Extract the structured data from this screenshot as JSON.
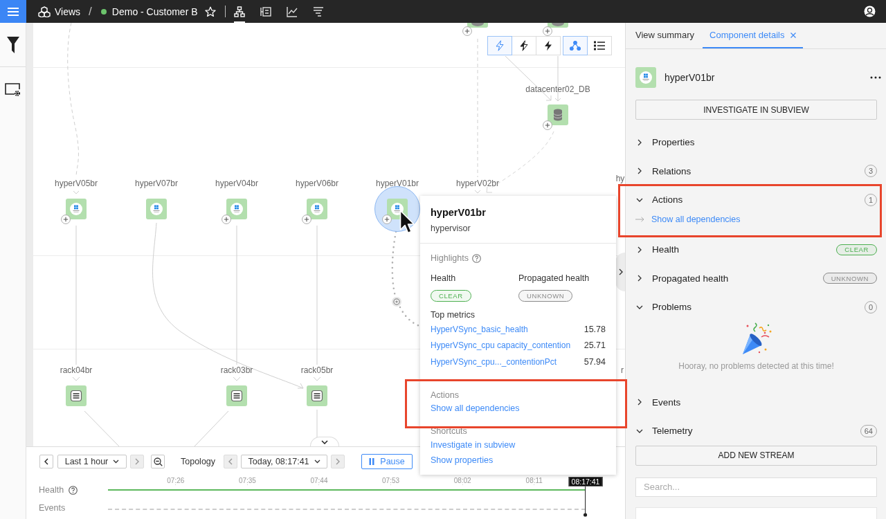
{
  "top_bar": {
    "root": "Views",
    "separator": "/",
    "view": {
      "name": "Demo - Customer B",
      "color": "#6cc46c"
    },
    "starred": false,
    "view_modes": [
      {
        "kind": "topology",
        "selected": true
      },
      {
        "kind": "components",
        "selected": false
      },
      {
        "kind": "metrics",
        "selected": false
      },
      {
        "kind": "events",
        "selected": false
      }
    ]
  },
  "canvas": {
    "toolbar": [
      {
        "kind": "bolt-outline",
        "selected": true
      },
      {
        "kind": "bolt-half",
        "selected": false
      },
      {
        "kind": "bolt-solid",
        "selected": false
      },
      {
        "kind": "graph",
        "selected": true
      },
      {
        "kind": "list",
        "selected": false
      }
    ],
    "nodes": [
      {
        "kind": "database",
        "expandable": true,
        "selected": false
      },
      {
        "kind": "database",
        "expandable": true,
        "selected": false
      },
      {
        "label": "datacenter02_DB",
        "kind": "database",
        "expandable": true,
        "selected": false
      },
      {
        "label": "hyperV05br",
        "kind": "windows",
        "expandable": true,
        "selected": false
      },
      {
        "label": "hyperV07br",
        "kind": "windows",
        "expandable": false,
        "selected": false
      },
      {
        "label": "hyperV04br",
        "kind": "windows",
        "expandable": true,
        "selected": false
      },
      {
        "label": "hyperV06br",
        "kind": "windows",
        "expandable": true,
        "selected": false
      },
      {
        "label": "hyperV01br",
        "kind": "windows",
        "expandable": true,
        "selected": true
      },
      {
        "label": "hyperV02br"
      },
      {
        "label": "hy"
      },
      {
        "label": "rack04br",
        "kind": "rack",
        "expandable": false,
        "selected": false
      },
      {
        "label": "rack03br",
        "kind": "rack",
        "expandable": false,
        "selected": false
      },
      {
        "label": "rack05br",
        "kind": "rack",
        "expandable": false,
        "selected": false
      },
      {
        "label": "r"
      }
    ]
  },
  "popup": {
    "title": "hyperV01br",
    "subtitle": "hypervisor",
    "highlights": "Highlights",
    "health": {
      "label": "Health",
      "status": {
        "label": "CLEAR",
        "color": "#4caf50"
      }
    },
    "propagated_health": {
      "label": "Propagated health",
      "status": {
        "label": "UNKNOWN",
        "color": "#8a8a8a"
      }
    },
    "metrics_title": "Top metrics",
    "metrics": [
      {
        "name": "HyperVSync_basic_health",
        "value": "15.78"
      },
      {
        "name": "HyperVSync_cpu capacity_contention",
        "value": "25.71"
      },
      {
        "name": "HyperVSync_cpu..._contentionPct",
        "value": "57.94"
      }
    ],
    "actions": {
      "title": "Actions",
      "highlighted": true,
      "links": [
        "Show all dependencies"
      ]
    },
    "shortcuts": {
      "title": "Shortcuts",
      "links": [
        "Investigate in subview",
        "Show properties"
      ]
    }
  },
  "details_panel": {
    "tabs": [
      {
        "label": "View summary",
        "selected": false,
        "closable": false
      },
      {
        "label": "Component details",
        "selected": true,
        "closable": true
      }
    ],
    "component": {
      "name": "hyperV01br",
      "kind": "windows"
    },
    "investigate_button": "INVESTIGATE IN SUBVIEW",
    "sections": [
      {
        "title": "Properties",
        "expanded": false,
        "highlighted": false
      },
      {
        "title": "Relations",
        "expanded": false,
        "highlighted": false,
        "count": "3"
      },
      {
        "title": "Actions",
        "expanded": true,
        "highlighted": true,
        "count": "1",
        "links": [
          "Show all dependencies"
        ]
      },
      {
        "title": "Health",
        "expanded": false,
        "highlighted": false,
        "status": {
          "label": "CLEAR",
          "color": "#4caf50"
        }
      },
      {
        "title": "Propagated health",
        "expanded": false,
        "highlighted": false,
        "status": {
          "label": "UNKNOWN",
          "color": "#8a8a8a"
        }
      },
      {
        "title": "Problems",
        "expanded": true,
        "highlighted": false,
        "count": "0",
        "empty_message": "Hooray, no problems detected at this time!"
      },
      {
        "title": "Events",
        "expanded": false,
        "highlighted": false
      },
      {
        "title": "Telemetry",
        "expanded": true,
        "highlighted": false,
        "count": "64",
        "button": "ADD NEW STREAM",
        "search": {
          "placeholder": "Search..."
        }
      }
    ]
  },
  "timeline": {
    "range": {
      "label": "Last 1 hour",
      "prev_disabled": false,
      "next_disabled": true
    },
    "mode": "Topology",
    "time": {
      "label": "Today, 08:17:41",
      "prev_disabled": true,
      "next_disabled": true
    },
    "pause": "Pause",
    "rows": [
      {
        "label": "Health",
        "help": true
      },
      {
        "label": "Events",
        "help": false
      }
    ],
    "ticks": [
      "07:26",
      "07:35",
      "07:44",
      "07:53",
      "08:02",
      "08:11"
    ],
    "current": "08:17:41"
  }
}
